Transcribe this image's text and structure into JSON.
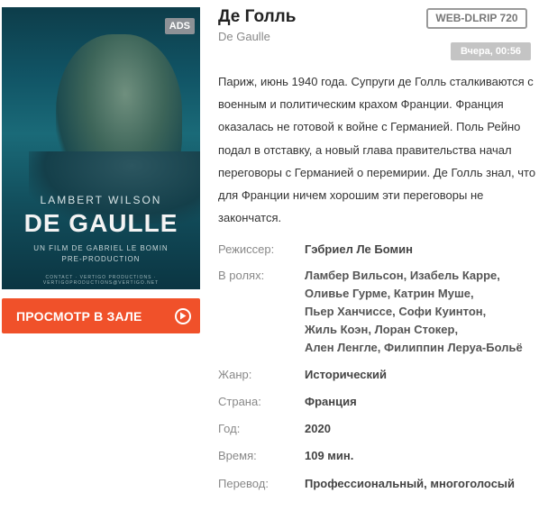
{
  "poster": {
    "ads_badge": "ADS",
    "actor": "LAMBERT WILSON",
    "title": "DE GAULLE",
    "subtitle_line1": "UN FILM DE GABRIEL LE BOMIN",
    "subtitle_line2": "PRE-PRODUCTION",
    "footer": "CONTACT · VERTIGO PRODUCTIONS · VERTIGOPRODUCTIONS@VERTIGO.NET"
  },
  "watch_button": {
    "label": "ПРОСМОТР В ЗАЛЕ",
    "icon": "play-circle-icon"
  },
  "movie": {
    "title": "Де Голль",
    "original_title": "De Gaulle",
    "quality": "WEB-DLRIP 720",
    "date": "Вчера, 00:56",
    "description": "Париж, июнь 1940 года. Супруги де Голль сталкиваются с военным и политическим крахом Франции. Франция оказалась не готовой к войне с Германией. Поль Рейно подал в отставку, а новый глава правительства начал переговоры с Германией о перемирии. Де Голль знал, что для Франции ничем хорошим эти переговоры не закончатся."
  },
  "info": {
    "director_label": "Режиссер:",
    "director": "Гэбриел Ле Бомин",
    "cast_label": "В ролях:",
    "cast": [
      "Ламбер Вильсон",
      "Изабель Карре",
      "Оливье Гурме",
      "Катрин Муше",
      "Пьер Ханчиссе",
      "Софи Куинтон",
      "Жиль Коэн",
      "Лоран Стокер",
      "Ален Ленгле",
      "Филиппин Леруа-Больё"
    ],
    "genre_label": "Жанр:",
    "genre": "Исторический",
    "country_label": "Страна:",
    "country": "Франция",
    "year_label": "Год:",
    "year": "2020",
    "duration_label": "Время:",
    "duration": "109 мин.",
    "translation_label": "Перевод:",
    "translation": "Профессиональный, многоголосый"
  },
  "colors": {
    "accent": "#f0512a",
    "badge_gray": "#c4c4c4",
    "label_gray": "#888888"
  }
}
